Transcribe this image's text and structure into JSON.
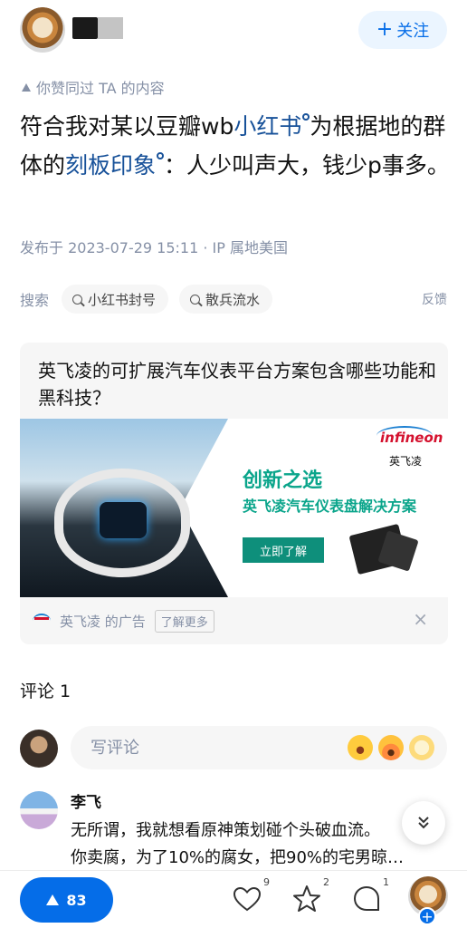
{
  "header": {
    "follow_label": "关注"
  },
  "hint": {
    "upvoted_text": "你赞同过 TA 的内容"
  },
  "post": {
    "part1": "符合我对某以豆瓣wb",
    "kw1": "小红书",
    "part2": "为根据地的群体的",
    "kw2": "刻板印象",
    "part3": "：人少叫声大，钱少p事多。",
    "published": "发布于 2023-07-29 15:11 · IP 属地美国"
  },
  "search": {
    "label": "搜索",
    "chips": [
      "小红书封号",
      "散兵流水"
    ],
    "feedback": "反馈"
  },
  "ad": {
    "question": "英飞凌的可扩展汽车仪表平台方案包含哪些功能和黑科技？",
    "logo_text": "infineon",
    "logo_cn": "英飞凌",
    "headline": "创新之选",
    "subline": "英飞凌汽车仪表盘解决方案",
    "cta": "立即了解",
    "brand": "英飞凌 的广告",
    "more": "了解更多",
    "close": "×"
  },
  "comments": {
    "title": "评论 1",
    "input_placeholder": "写评论",
    "items": [
      {
        "name": "李飞",
        "line1": "无所谓，我就想看原神策划碰个头破血流。",
        "line2": "你卖腐，为了10%的腐女，把90%的宅男晾…"
      }
    ]
  },
  "bottom": {
    "vote_count": "83",
    "likes": "9",
    "favorites": "2",
    "comments": "1"
  },
  "colors": {
    "accent": "#056de8",
    "link": "#175199",
    "meta": "#8590a6"
  }
}
